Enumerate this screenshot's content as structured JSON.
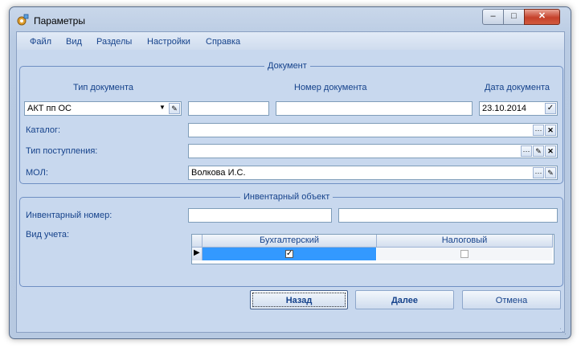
{
  "window": {
    "title": "Параметры",
    "icon": "settings-app-icon",
    "buttons": [
      "minimize",
      "maximize",
      "close"
    ]
  },
  "menu": [
    "Файл",
    "Вид",
    "Разделы",
    "Настройки",
    "Справка"
  ],
  "document_group": {
    "legend": "Документ",
    "col_doc_type": "Тип документа",
    "col_doc_number": "Номер документа",
    "col_doc_date": "Дата документа",
    "doc_type_value": "АКТ пп ОС",
    "doc_number_1": "",
    "doc_number_2": "",
    "doc_date_value": "23.10.2014",
    "catalog_label": "Каталог:",
    "catalog_value": "",
    "receipt_type_label": "Тип поступления:",
    "receipt_type_value": "",
    "mol_label": "МОЛ:",
    "mol_value": "Волкова И.С."
  },
  "inventory_group": {
    "legend": "Инвентарный объект",
    "inv_number_label": "Инвентарный номер:",
    "inv_number_1": "",
    "inv_number_2": "",
    "accounting_type_label": "Вид учета:",
    "grid_columns": [
      "Бухгалтерский",
      "Налоговый"
    ],
    "grid_row": {
      "accounting_checked": true,
      "tax_checked": false
    }
  },
  "buttons": {
    "back": "Назад",
    "next": "Далее",
    "cancel": "Отмена"
  },
  "colors": {
    "accent": "#15428b",
    "selected_cell": "#3399ff",
    "frame": "#6f8fc3"
  }
}
